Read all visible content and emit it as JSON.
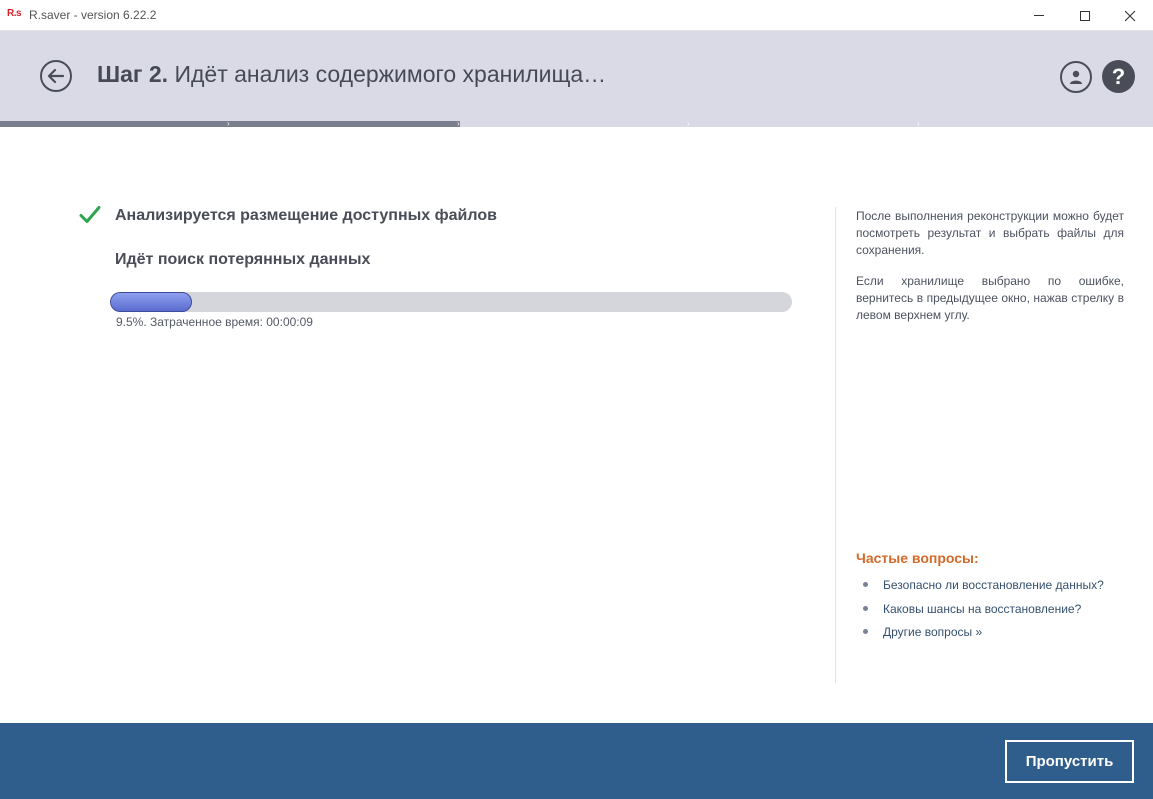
{
  "titlebar": {
    "logo": "R.s",
    "title": "R.saver - version 6.22.2"
  },
  "header": {
    "step_number": "Шаг 2.",
    "step_text": "Идёт анализ содержимого хранилища…",
    "help_label": "?"
  },
  "steps": {
    "done_count": 2,
    "total": 5
  },
  "main": {
    "task_done": "Анализируется размещение доступных файлов",
    "task_current": "Идёт поиск потерянных данных",
    "progress_fraction": 0.095,
    "progress_text": "9.5%. Затраченное время: 00:00:09"
  },
  "sidebar": {
    "para1": "После выполнения реконструкции можно будет посмотреть результат и выбрать файлы для сохранения.",
    "para2": "Если хранилище выбрано по ошибке, вернитесь в предыдущее окно, нажав стрелку в левом верхнем углу.",
    "faq_title": "Частые вопросы:",
    "faq_items": [
      {
        "label": "Безопасно ли восстановление данных?"
      },
      {
        "label": "Каковы шансы на восстановление?"
      },
      {
        "label": "Другие вопросы »"
      }
    ]
  },
  "footer": {
    "skip_label": "Пропустить"
  },
  "colors": {
    "header_bg": "#d9dae6",
    "footer_bg": "#2f5e8c",
    "accent_check": "#2ea44f",
    "faq_title": "#d46a2a",
    "progress_fill": "#6b7bdb"
  }
}
